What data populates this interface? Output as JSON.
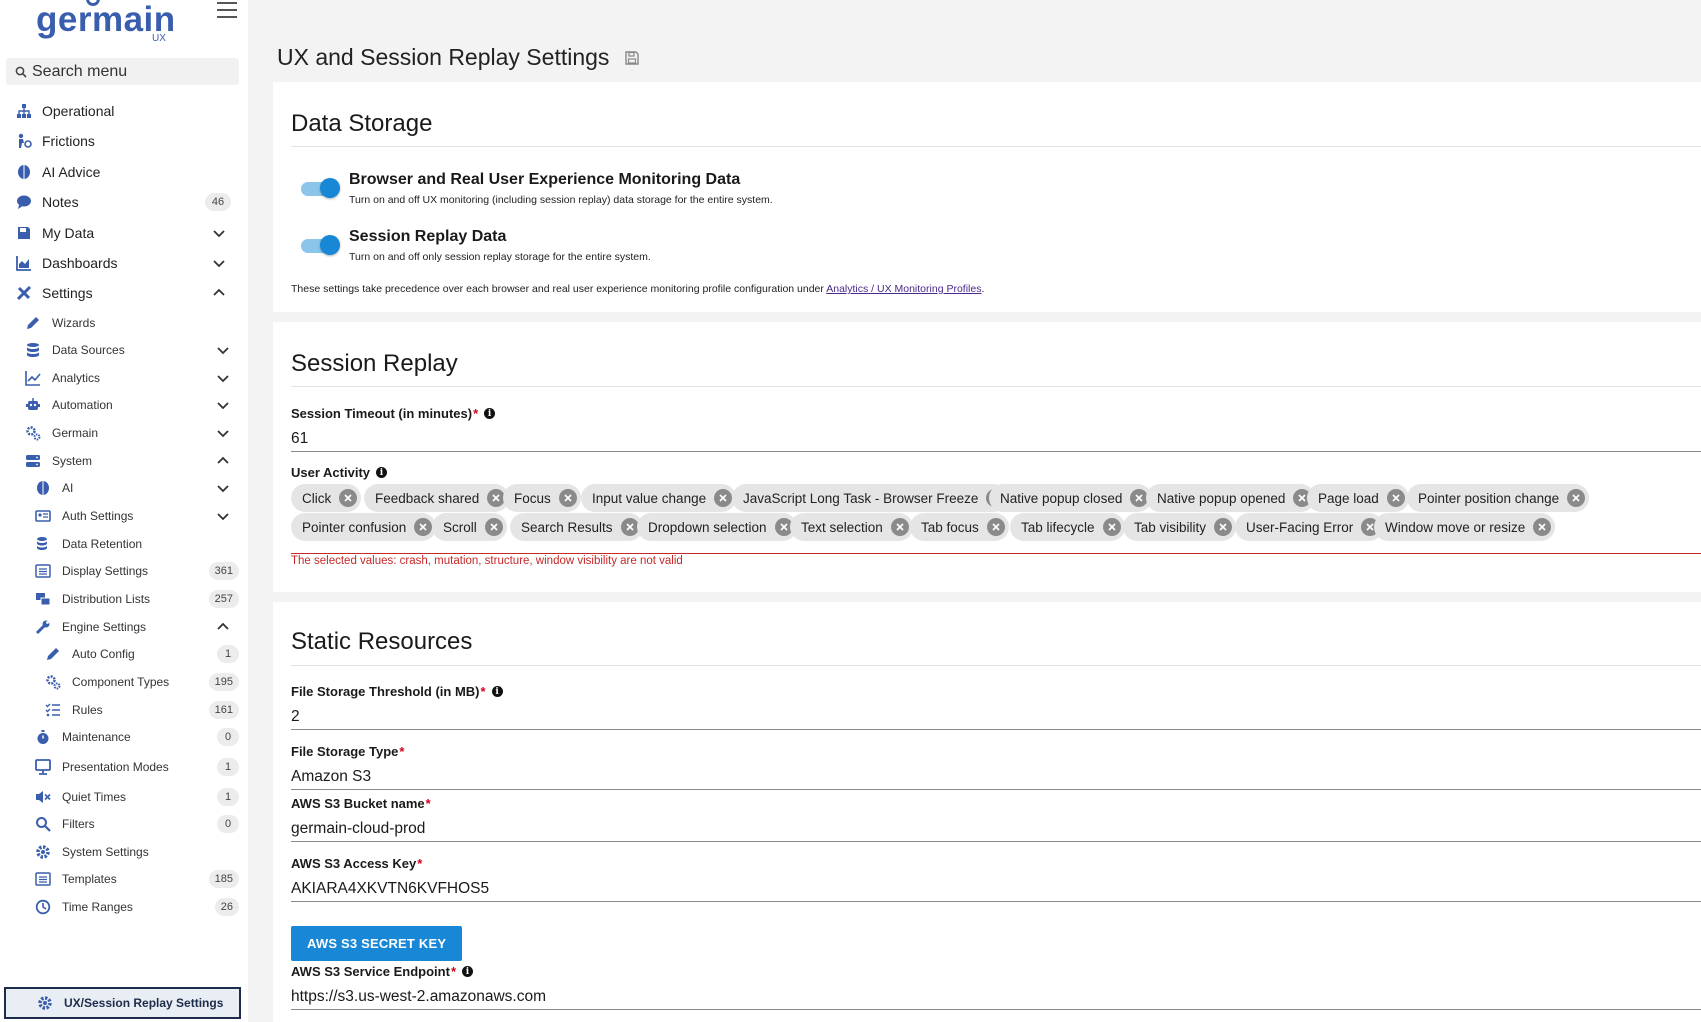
{
  "app": {
    "logo_text": "germain",
    "logo_sub": "UX"
  },
  "colors": {
    "accent": "#1787d6",
    "nav_icon": "#3a5eae",
    "error": "#c62828",
    "required": "#d0021b"
  },
  "sidebar": {
    "search_placeholder": "Search menu",
    "items": [
      {
        "label": "Operational",
        "icon": "sitemap-icon"
      },
      {
        "label": "Frictions",
        "icon": "frictions-icon"
      },
      {
        "label": "AI Advice",
        "icon": "brain-icon"
      },
      {
        "label": "Notes",
        "icon": "comment-icon",
        "badge": "46"
      },
      {
        "label": "My Data",
        "icon": "save-icon"
      },
      {
        "label": "Dashboards",
        "icon": "chart-area-icon"
      },
      {
        "label": "Settings",
        "icon": "tools-icon"
      },
      {
        "label": "Wizards",
        "icon": "pencil-icon"
      },
      {
        "label": "Data Sources",
        "icon": "database-icon"
      },
      {
        "label": "Analytics",
        "icon": "line-chart-icon"
      },
      {
        "label": "Automation",
        "icon": "robot-icon"
      },
      {
        "label": "Germain",
        "icon": "cogs-icon"
      },
      {
        "label": "System",
        "icon": "server-icon"
      },
      {
        "label": "AI",
        "icon": "brain-icon"
      },
      {
        "label": "Auth Settings",
        "icon": "id-card-icon"
      },
      {
        "label": "Data Retention",
        "icon": "database-clock-icon"
      },
      {
        "label": "Display Settings",
        "icon": "list-alt-icon",
        "badge": "361"
      },
      {
        "label": "Distribution Lists",
        "icon": "mail-bulk-icon",
        "badge": "257"
      },
      {
        "label": "Engine Settings",
        "icon": "wrench-icon"
      },
      {
        "label": "Auto Config",
        "icon": "pencil-icon",
        "badge": "1"
      },
      {
        "label": "Component Types",
        "icon": "cogs-icon",
        "badge": "195"
      },
      {
        "label": "Rules",
        "icon": "tasks-icon",
        "badge": "161"
      },
      {
        "label": "Maintenance",
        "icon": "stopwatch-icon",
        "badge": "0"
      },
      {
        "label": "Presentation Modes",
        "icon": "desktop-icon",
        "badge": "1"
      },
      {
        "label": "Quiet Times",
        "icon": "volume-mute-icon",
        "badge": "1"
      },
      {
        "label": "Filters",
        "icon": "search-icon",
        "badge": "0"
      },
      {
        "label": "System Settings",
        "icon": "gear-icon"
      },
      {
        "label": "Templates",
        "icon": "list-alt-icon",
        "badge": "185"
      },
      {
        "label": "Time Ranges",
        "icon": "clock-icon",
        "badge": "26"
      },
      {
        "label": "UX/Session Replay Settings",
        "icon": "gear-icon"
      }
    ]
  },
  "page": {
    "title": "UX and Session Replay Settings"
  },
  "data_storage": {
    "title": "Data Storage",
    "toggles": [
      {
        "title": "Browser and Real User Experience Monitoring Data",
        "desc": "Turn on and off UX monitoring (including session replay) data storage for the entire system.",
        "on": true
      },
      {
        "title": "Session Replay Data",
        "desc": "Turn on and off only session replay storage for the entire system.",
        "on": true
      }
    ],
    "note": "These settings take precedence over each browser and real user experience monitoring profile configuration under ",
    "note_link": "Analytics / UX Monitoring Profiles",
    "note_end": "."
  },
  "session_replay": {
    "title": "Session Replay",
    "timeout_label": "Session Timeout (in minutes)",
    "timeout_value": "61",
    "activity_label": "User Activity",
    "activities": [
      "Click",
      "Feedback shared",
      "Focus",
      "Input value change",
      "JavaScript Long Task - Browser Freeze",
      "Native popup closed",
      "Native popup opened",
      "Page load",
      "Pointer position change",
      "Pointer confusion",
      "Scroll",
      "Search Results",
      "Dropdown selection",
      "Text selection",
      "Tab focus",
      "Tab lifecycle",
      "Tab visibility",
      "User-Facing Error",
      "Window move or resize"
    ],
    "error": "The selected values: crash, mutation, structure, window visibility are not valid"
  },
  "static_resources": {
    "title": "Static Resources",
    "threshold_label": "File Storage Threshold (in MB)",
    "threshold_value": "2",
    "type_label": "File Storage Type",
    "type_value": "Amazon S3",
    "bucket_label": "AWS S3 Bucket name",
    "bucket_value": "germain-cloud-prod",
    "access_key_label": "AWS S3 Access Key",
    "access_key_value": "AKIARA4XKVTN6KVFHOS5",
    "secret_button": "AWS S3 SECRET KEY",
    "endpoint_label": "AWS S3 Service Endpoint",
    "endpoint_value": "https://s3.us-west-2.amazonaws.com"
  }
}
